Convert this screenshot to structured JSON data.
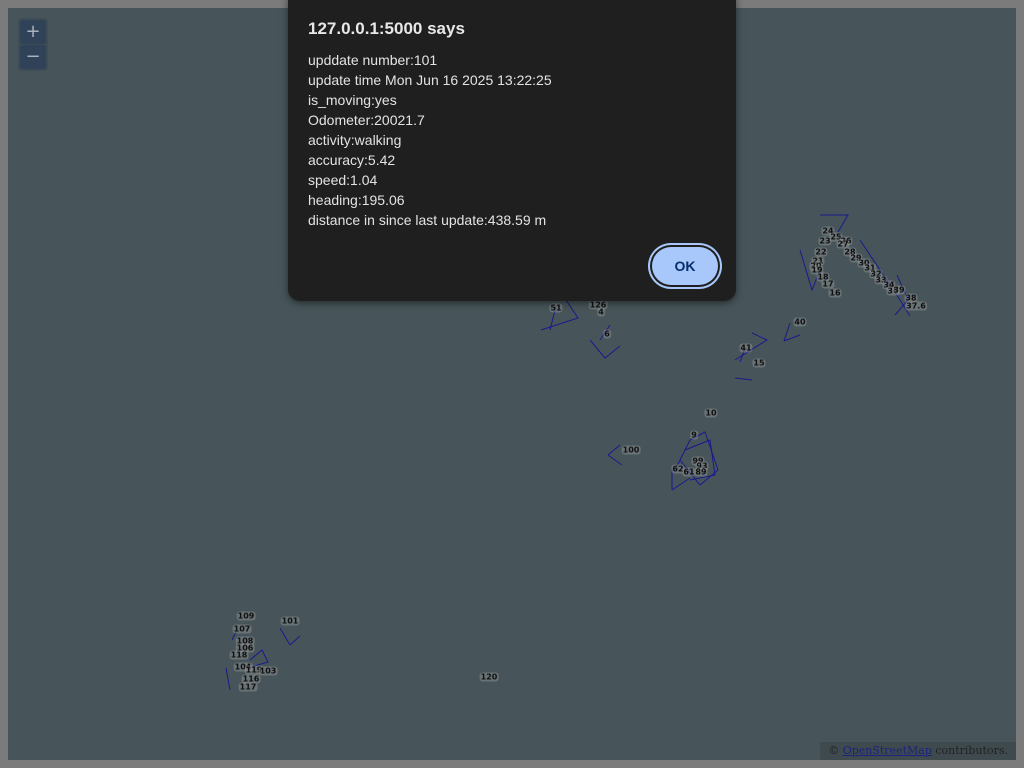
{
  "map": {
    "zoom_in_label": "+",
    "zoom_out_label": "−",
    "attribution": {
      "prefix": "©",
      "link": "OpenStreetMap",
      "suffix": "contributors."
    },
    "track_color": "#1a1a8c",
    "marker_labels": [
      "24",
      "25",
      "26",
      "27",
      "23",
      "28",
      "22",
      "29",
      "30",
      "21",
      "20",
      "19",
      "31",
      "32",
      "18",
      "33",
      "34",
      "17",
      "35",
      "39",
      "16",
      "38",
      "37.6",
      "51",
      "126",
      "4",
      "6",
      "40",
      "41",
      "15",
      "10",
      "9",
      "100",
      "99",
      "93",
      "62",
      "61",
      "89",
      "109",
      "101",
      "107",
      "108",
      "106",
      "118",
      "104",
      "119",
      "103",
      "116",
      "117",
      "120"
    ]
  },
  "dialog": {
    "title": "127.0.0.1:5000 says",
    "lines": [
      "upddate number:101",
      "update time Mon Jun 16 2025 13:22:25",
      "is_moving:yes",
      "Odometer:20021.7",
      "activity:walking",
      "accuracy:5.42",
      "speed:1.04",
      "heading:195.06",
      "distance in since last update:438.59 m"
    ],
    "ok_label": "OK"
  }
}
